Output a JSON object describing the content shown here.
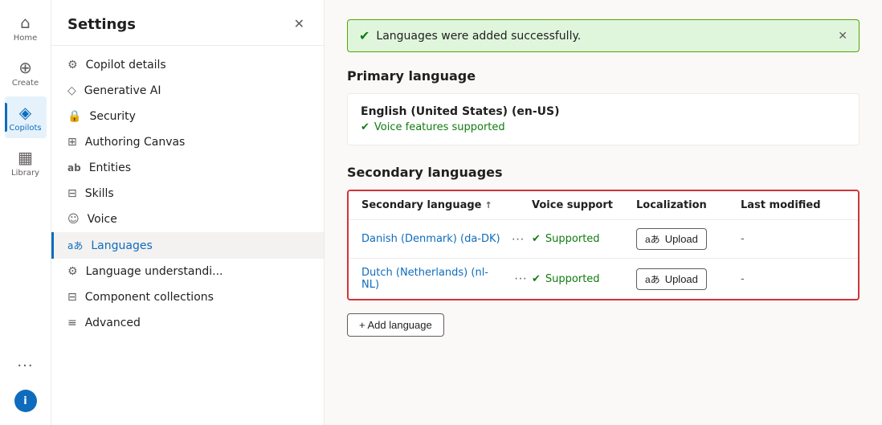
{
  "app": {
    "title": "Settings",
    "close_label": "✕"
  },
  "left_nav": {
    "items": [
      {
        "id": "home",
        "label": "Home",
        "icon": "⌂",
        "active": false
      },
      {
        "id": "create",
        "label": "Create",
        "icon": "⊕",
        "active": false
      },
      {
        "id": "copilots",
        "label": "Copilots",
        "icon": "◈",
        "active": true
      },
      {
        "id": "library",
        "label": "Library",
        "icon": "▦",
        "active": false
      },
      {
        "id": "more",
        "label": "···",
        "icon": "···",
        "active": false
      }
    ],
    "info_label": "i"
  },
  "settings_nav": {
    "items": [
      {
        "id": "copilot-details",
        "label": "Copilot details",
        "icon": "⚙",
        "active": false
      },
      {
        "id": "generative-ai",
        "label": "Generative AI",
        "icon": "◇",
        "active": false
      },
      {
        "id": "security",
        "label": "Security",
        "icon": "🔒",
        "active": false
      },
      {
        "id": "authoring-canvas",
        "label": "Authoring Canvas",
        "icon": "⊞",
        "active": false
      },
      {
        "id": "entities",
        "label": "Entities",
        "icon": "ab",
        "active": false
      },
      {
        "id": "skills",
        "label": "Skills",
        "icon": "⊟",
        "active": false
      },
      {
        "id": "voice",
        "label": "Voice",
        "icon": "☺",
        "active": false
      },
      {
        "id": "languages",
        "label": "Languages",
        "icon": "aあ",
        "active": true
      },
      {
        "id": "language-understanding",
        "label": "Language understandi...",
        "icon": "⚙",
        "active": false
      },
      {
        "id": "component-collections",
        "label": "Component collections",
        "icon": "⊟",
        "active": false
      },
      {
        "id": "advanced",
        "label": "Advanced",
        "icon": "≡",
        "active": false
      }
    ]
  },
  "main": {
    "success_banner": {
      "text": "Languages were added successfully.",
      "close_label": "✕"
    },
    "primary_language": {
      "section_title": "Primary language",
      "language_name": "English (United States) (en-US)",
      "voice_label": "Voice features supported"
    },
    "secondary_languages": {
      "section_title": "Secondary languages",
      "table": {
        "headers": {
          "language": "Secondary language",
          "sort_icon": "↑",
          "voice_support": "Voice support",
          "localization": "Localization",
          "last_modified": "Last modified"
        },
        "rows": [
          {
            "language": "Danish (Denmark) (da-DK)",
            "more_icon": "···",
            "voice_support": "Supported",
            "upload_icon": "aあ",
            "upload_label": "Upload",
            "last_modified": "-"
          },
          {
            "language": "Dutch (Netherlands) (nl-NL)",
            "more_icon": "···",
            "voice_support": "Supported",
            "upload_icon": "aあ",
            "upload_label": "Upload",
            "last_modified": "-"
          }
        ]
      }
    },
    "add_language": {
      "label": "+ Add language"
    }
  },
  "colors": {
    "accent": "#0f6cbd",
    "success": "#107c10",
    "danger": "#d13438"
  }
}
